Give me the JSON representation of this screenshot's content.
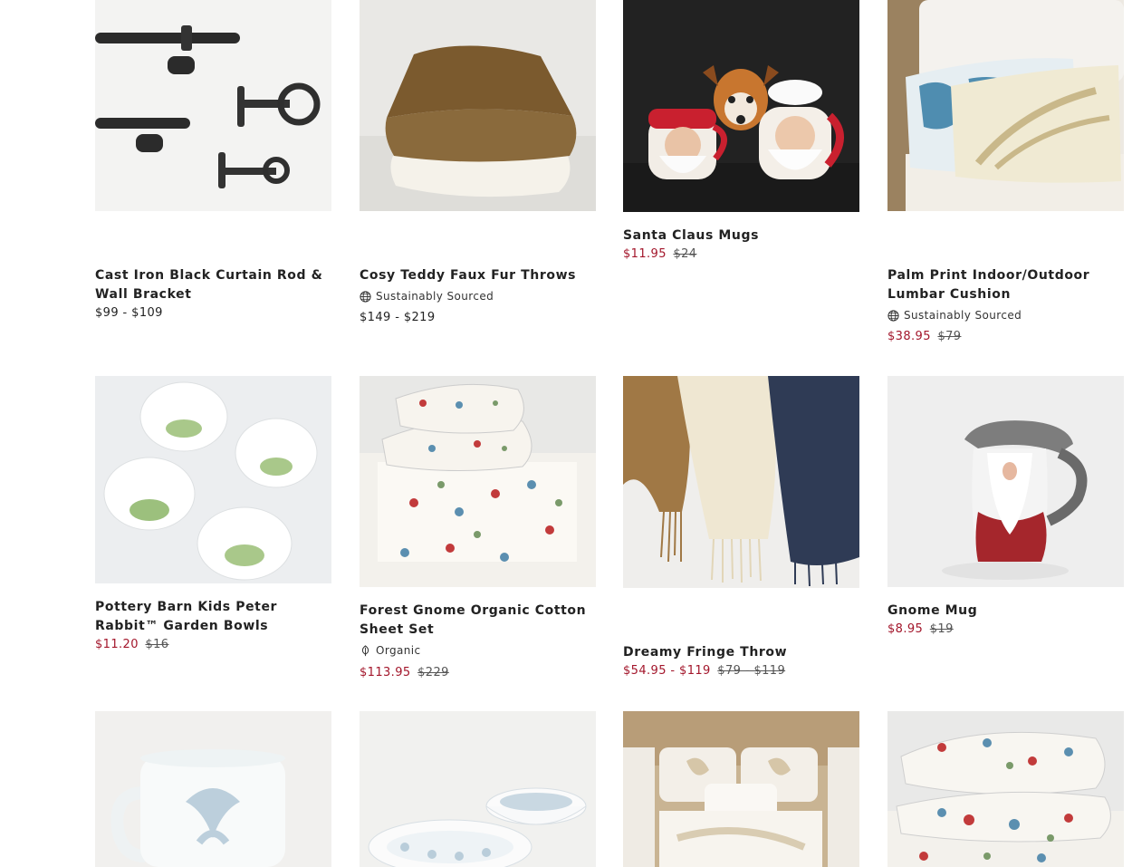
{
  "colors": {
    "sale": "#a3162b",
    "text": "#222222",
    "image_bg": "#f2f1ef"
  },
  "products": [
    {
      "name": "Cast Iron Black Curtain Rod & Wall Bracket",
      "badge": "",
      "price": "$99 - $109",
      "sale_price": "",
      "original_price": "",
      "image": "curtain-rod-image"
    },
    {
      "name": "Cosy Teddy Faux Fur Throws",
      "badge": "Sustainably Sourced",
      "badge_icon": "globe-icon",
      "price": "$149 - $219",
      "sale_price": "",
      "original_price": "",
      "image": "throws-image"
    },
    {
      "name": "Santa Claus Mugs",
      "badge": "",
      "price": "",
      "sale_price": "$11.95",
      "original_price": "$24",
      "image": "santa-mugs-image"
    },
    {
      "name": "Palm Print Indoor/Outdoor Lumbar Cushion",
      "badge": "Sustainably Sourced",
      "badge_icon": "globe-icon",
      "price": "",
      "sale_price": "$38.95",
      "original_price": "$79",
      "image": "cushion-image"
    },
    {
      "name": "Pottery Barn Kids Peter Rabbit™ Garden Bowls",
      "badge": "",
      "price": "",
      "sale_price": "$11.20",
      "original_price": "$16",
      "image": "bowls-image"
    },
    {
      "name": "Forest Gnome Organic Cotton Sheet Set",
      "badge": "Organic",
      "badge_icon": "leaf-icon",
      "price": "",
      "sale_price": "$113.95",
      "original_price": "$229",
      "image": "sheet-set-image"
    },
    {
      "name": "Dreamy Fringe Throw",
      "badge": "",
      "price": "",
      "sale_price": "$54.95 - $119",
      "original_price": "$79 - $119",
      "image": "fringe-throw-image"
    },
    {
      "name": "Gnome Mug",
      "badge": "",
      "price": "",
      "sale_price": "$8.95",
      "original_price": "$19",
      "image": "gnome-mug-image"
    },
    {
      "image": "mug-image"
    },
    {
      "image": "dinner-bowls-image"
    },
    {
      "image": "bedding-image"
    },
    {
      "image": "gnome-pillow-image"
    }
  ]
}
